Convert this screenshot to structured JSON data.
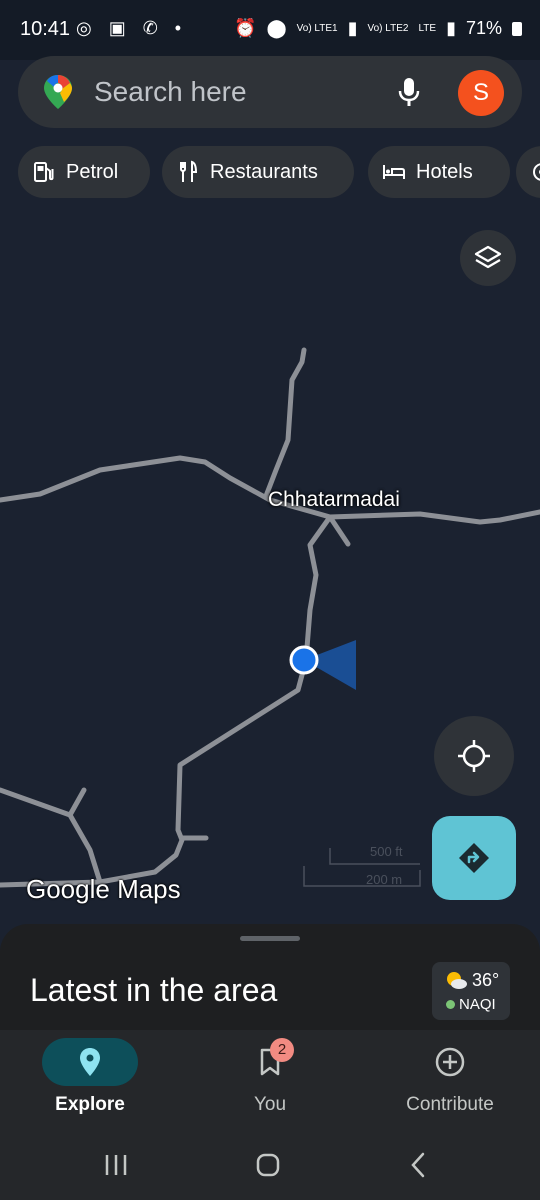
{
  "status_bar": {
    "time": "10:41",
    "network_1": "Vo) LTE1",
    "network_2": "Vo) LTE2",
    "network_3": "LTE",
    "battery": "71%"
  },
  "search": {
    "placeholder": "Search here",
    "avatar_initial": "S"
  },
  "chips": [
    {
      "label": "Petrol",
      "icon": "fuel-icon"
    },
    {
      "label": "Restaurants",
      "icon": "fork-knife-icon"
    },
    {
      "label": "Hotels",
      "icon": "bed-icon"
    },
    {
      "label": "",
      "icon": "more-category-icon"
    }
  ],
  "map": {
    "place_label": "Chhatarmadai",
    "logo_text": "Google Maps",
    "scale_top": "500 ft",
    "scale_bottom": "200 m"
  },
  "sheet": {
    "title": "Latest in the area",
    "weather_temp": "36°",
    "aqi_label": "NAQI"
  },
  "bottom_nav": [
    {
      "label": "Explore",
      "icon": "location-pin-icon",
      "active": true
    },
    {
      "label": "You",
      "icon": "bookmark-icon",
      "badge": "2"
    },
    {
      "label": "Contribute",
      "icon": "add-circle-icon"
    }
  ],
  "colors": {
    "map_background": "#1b2230",
    "road": "#8d9096",
    "accent_teal": "#5fc4d4",
    "location_blue": "#1a73e8",
    "avatar": "#f4511e"
  }
}
